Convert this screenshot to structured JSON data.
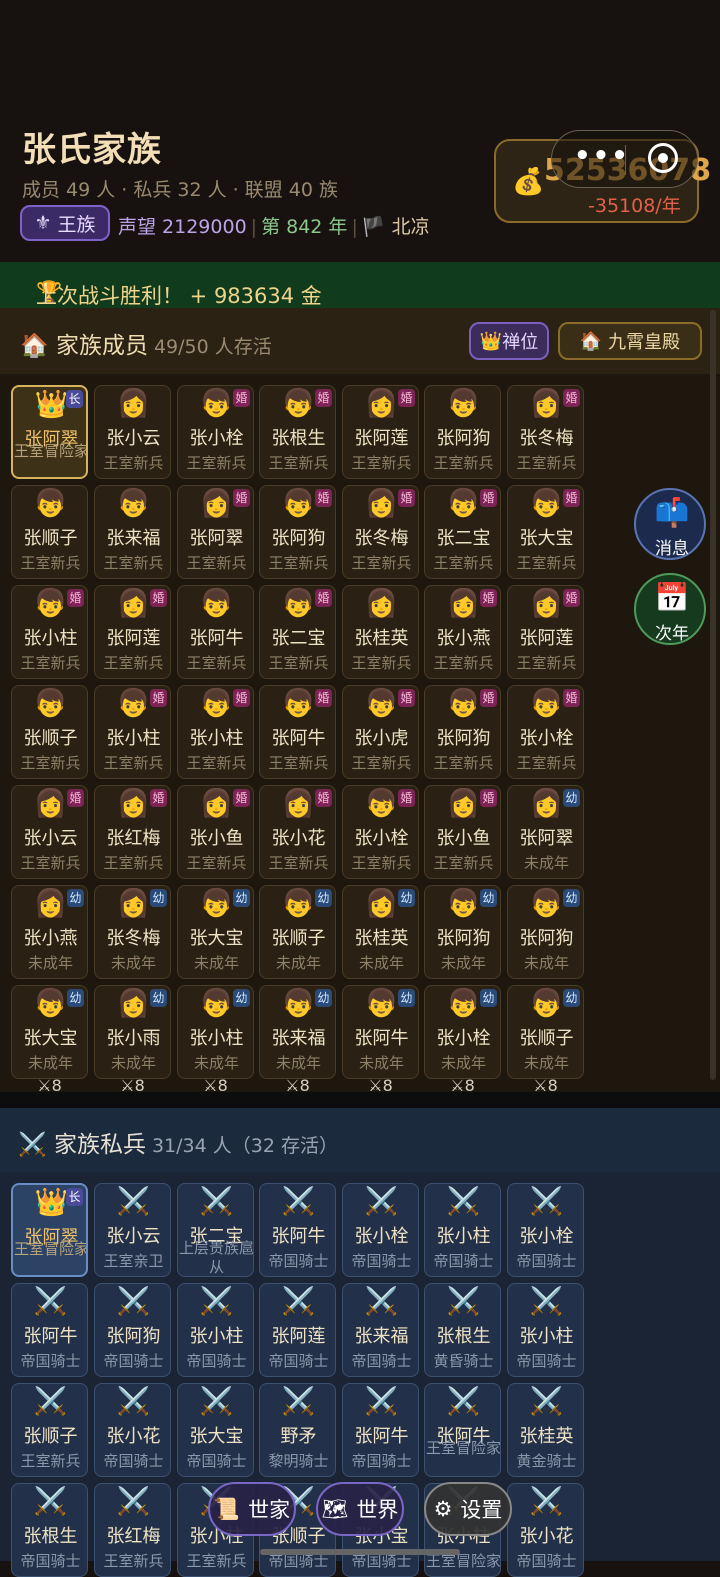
{
  "header": {
    "title": "张氏家族",
    "stats": "成员 49 人 · 私兵 32 人 · 联盟 40 族",
    "rank_badge": "王族",
    "prestige": "声望 2129000",
    "year": "第 842 年",
    "location": "北凉",
    "money": "52536078",
    "money_rate": "-35108/年"
  },
  "victory": {
    "text": "上次战斗胜利！ + 983634 金"
  },
  "members": {
    "title": "家族成员",
    "count": "49/50 人存活",
    "abdicate_label": "禅位",
    "palace_label": "九霄皇殿",
    "cards": [
      {
        "name": "张阿翠",
        "rank": "王室冒险家",
        "avatar": "👑",
        "tag": "长",
        "tag_type": "lead",
        "leader": true
      },
      {
        "name": "张小云",
        "rank": "王室新兵",
        "avatar": "👩",
        "tag": "",
        "tag_type": ""
      },
      {
        "name": "张小栓",
        "rank": "王室新兵",
        "avatar": "👦",
        "tag": "婚",
        "tag_type": "marry"
      },
      {
        "name": "张根生",
        "rank": "王室新兵",
        "avatar": "👦",
        "tag": "婚",
        "tag_type": "marry"
      },
      {
        "name": "张阿莲",
        "rank": "王室新兵",
        "avatar": "👩",
        "tag": "婚",
        "tag_type": "marry"
      },
      {
        "name": "张阿狗",
        "rank": "王室新兵",
        "avatar": "👦",
        "tag": "",
        "tag_type": ""
      },
      {
        "name": "张冬梅",
        "rank": "王室新兵",
        "avatar": "👩",
        "tag": "婚",
        "tag_type": "marry"
      },
      {
        "name": "张顺子",
        "rank": "王室新兵",
        "avatar": "👦",
        "tag": "",
        "tag_type": ""
      },
      {
        "name": "张来福",
        "rank": "王室新兵",
        "avatar": "👦",
        "tag": "",
        "tag_type": ""
      },
      {
        "name": "张阿翠",
        "rank": "王室新兵",
        "avatar": "👩",
        "tag": "婚",
        "tag_type": "marry"
      },
      {
        "name": "张阿狗",
        "rank": "王室新兵",
        "avatar": "👦",
        "tag": "婚",
        "tag_type": "marry"
      },
      {
        "name": "张冬梅",
        "rank": "王室新兵",
        "avatar": "👩",
        "tag": "婚",
        "tag_type": "marry"
      },
      {
        "name": "张二宝",
        "rank": "王室新兵",
        "avatar": "👦",
        "tag": "婚",
        "tag_type": "marry"
      },
      {
        "name": "张大宝",
        "rank": "王室新兵",
        "avatar": "👦",
        "tag": "婚",
        "tag_type": "marry"
      },
      {
        "name": "张小柱",
        "rank": "王室新兵",
        "avatar": "👦",
        "tag": "婚",
        "tag_type": "marry"
      },
      {
        "name": "张阿莲",
        "rank": "王室新兵",
        "avatar": "👩",
        "tag": "婚",
        "tag_type": "marry"
      },
      {
        "name": "张阿牛",
        "rank": "王室新兵",
        "avatar": "👦",
        "tag": "",
        "tag_type": ""
      },
      {
        "name": "张二宝",
        "rank": "王室新兵",
        "avatar": "👦",
        "tag": "婚",
        "tag_type": "marry"
      },
      {
        "name": "张桂英",
        "rank": "王室新兵",
        "avatar": "👩",
        "tag": "",
        "tag_type": ""
      },
      {
        "name": "张小燕",
        "rank": "王室新兵",
        "avatar": "👩",
        "tag": "婚",
        "tag_type": "marry"
      },
      {
        "name": "张阿莲",
        "rank": "王室新兵",
        "avatar": "👩",
        "tag": "婚",
        "tag_type": "marry"
      },
      {
        "name": "张顺子",
        "rank": "王室新兵",
        "avatar": "👦",
        "tag": "",
        "tag_type": ""
      },
      {
        "name": "张小柱",
        "rank": "王室新兵",
        "avatar": "👦",
        "tag": "婚",
        "tag_type": "marry"
      },
      {
        "name": "张小柱",
        "rank": "王室新兵",
        "avatar": "👦",
        "tag": "婚",
        "tag_type": "marry"
      },
      {
        "name": "张阿牛",
        "rank": "王室新兵",
        "avatar": "👦",
        "tag": "婚",
        "tag_type": "marry"
      },
      {
        "name": "张小虎",
        "rank": "王室新兵",
        "avatar": "👦",
        "tag": "婚",
        "tag_type": "marry"
      },
      {
        "name": "张阿狗",
        "rank": "王室新兵",
        "avatar": "👦",
        "tag": "婚",
        "tag_type": "marry"
      },
      {
        "name": "张小栓",
        "rank": "王室新兵",
        "avatar": "👦",
        "tag": "婚",
        "tag_type": "marry"
      },
      {
        "name": "张小云",
        "rank": "王室新兵",
        "avatar": "👩",
        "tag": "婚",
        "tag_type": "marry"
      },
      {
        "name": "张红梅",
        "rank": "王室新兵",
        "avatar": "👩",
        "tag": "婚",
        "tag_type": "marry"
      },
      {
        "name": "张小鱼",
        "rank": "王室新兵",
        "avatar": "👩",
        "tag": "婚",
        "tag_type": "marry"
      },
      {
        "name": "张小花",
        "rank": "王室新兵",
        "avatar": "👩",
        "tag": "婚",
        "tag_type": "marry"
      },
      {
        "name": "张小栓",
        "rank": "王室新兵",
        "avatar": "👦",
        "tag": "婚",
        "tag_type": "marry"
      },
      {
        "name": "张小鱼",
        "rank": "王室新兵",
        "avatar": "👩",
        "tag": "婚",
        "tag_type": "marry"
      },
      {
        "name": "张阿翠",
        "rank": "未成年",
        "avatar": "👩",
        "tag": "幼",
        "tag_type": "young"
      },
      {
        "name": "张小燕",
        "rank": "未成年",
        "avatar": "👩",
        "tag": "幼",
        "tag_type": "young"
      },
      {
        "name": "张冬梅",
        "rank": "未成年",
        "avatar": "👩",
        "tag": "幼",
        "tag_type": "young"
      },
      {
        "name": "张大宝",
        "rank": "未成年",
        "avatar": "👦",
        "tag": "幼",
        "tag_type": "young"
      },
      {
        "name": "张顺子",
        "rank": "未成年",
        "avatar": "👦",
        "tag": "幼",
        "tag_type": "young"
      },
      {
        "name": "张桂英",
        "rank": "未成年",
        "avatar": "👩",
        "tag": "幼",
        "tag_type": "young"
      },
      {
        "name": "张阿狗",
        "rank": "未成年",
        "avatar": "👦",
        "tag": "幼",
        "tag_type": "young"
      },
      {
        "name": "张阿狗",
        "rank": "未成年",
        "avatar": "👦",
        "tag": "幼",
        "tag_type": "young"
      },
      {
        "name": "张大宝",
        "rank": "未成年",
        "avatar": "👦",
        "tag": "幼",
        "tag_type": "young"
      },
      {
        "name": "张小雨",
        "rank": "未成年",
        "avatar": "👩",
        "tag": "幼",
        "tag_type": "young"
      },
      {
        "name": "张小柱",
        "rank": "未成年",
        "avatar": "👦",
        "tag": "幼",
        "tag_type": "young"
      },
      {
        "name": "张来福",
        "rank": "未成年",
        "avatar": "👦",
        "tag": "幼",
        "tag_type": "young"
      },
      {
        "name": "张阿牛",
        "rank": "未成年",
        "avatar": "👦",
        "tag": "幼",
        "tag_type": "young"
      },
      {
        "name": "张小栓",
        "rank": "未成年",
        "avatar": "👦",
        "tag": "幼",
        "tag_type": "young"
      },
      {
        "name": "张顺子",
        "rank": "未成年",
        "avatar": "👦",
        "tag": "幼",
        "tag_type": "young"
      }
    ],
    "footer_counts": [
      "⚔8",
      "⚔8",
      "⚔8",
      "⚔8",
      "⚔8",
      "⚔8",
      "⚔8"
    ]
  },
  "soldiers": {
    "title": "家族私兵",
    "count": "31/34 人（32 存活）",
    "cards": [
      {
        "name": "张阿翠",
        "rank": "王室冒险家",
        "avatar": "👑",
        "tag": "长",
        "leader": true
      },
      {
        "name": "张小云",
        "rank": "王室亲卫",
        "avatar": "⚔️"
      },
      {
        "name": "张二宝",
        "rank": "上层贵族扈从",
        "avatar": "⚔️",
        "wrap": true
      },
      {
        "name": "张阿牛",
        "rank": "帝国骑士",
        "avatar": "⚔️"
      },
      {
        "name": "张小栓",
        "rank": "帝国骑士",
        "avatar": "⚔️"
      },
      {
        "name": "张小柱",
        "rank": "帝国骑士",
        "avatar": "⚔️"
      },
      {
        "name": "张小栓",
        "rank": "帝国骑士",
        "avatar": "⚔️"
      },
      {
        "name": "张阿牛",
        "rank": "帝国骑士",
        "avatar": "⚔️"
      },
      {
        "name": "张阿狗",
        "rank": "帝国骑士",
        "avatar": "⚔️"
      },
      {
        "name": "张小柱",
        "rank": "帝国骑士",
        "avatar": "⚔️"
      },
      {
        "name": "张阿莲",
        "rank": "帝国骑士",
        "avatar": "⚔️"
      },
      {
        "name": "张来福",
        "rank": "帝国骑士",
        "avatar": "⚔️"
      },
      {
        "name": "张根生",
        "rank": "黄昏骑士",
        "avatar": "⚔️"
      },
      {
        "name": "张小柱",
        "rank": "帝国骑士",
        "avatar": "⚔️"
      },
      {
        "name": "张顺子",
        "rank": "王室新兵",
        "avatar": "⚔️"
      },
      {
        "name": "张小花",
        "rank": "帝国骑士",
        "avatar": "⚔️"
      },
      {
        "name": "张大宝",
        "rank": "帝国骑士",
        "avatar": "⚔️"
      },
      {
        "name": "野矛",
        "rank": "黎明骑士",
        "avatar": "⚔️"
      },
      {
        "name": "张阿牛",
        "rank": "帝国骑士",
        "avatar": "⚔️"
      },
      {
        "name": "张阿牛",
        "rank": "王室冒险家",
        "avatar": "⚔️",
        "wrap": true
      },
      {
        "name": "张桂英",
        "rank": "黄金骑士",
        "avatar": "⚔️"
      },
      {
        "name": "张根生",
        "rank": "帝国骑士",
        "avatar": "⚔️"
      },
      {
        "name": "张红梅",
        "rank": "王室新兵",
        "avatar": "⚔️"
      },
      {
        "name": "张小柱",
        "rank": "王室新兵",
        "avatar": "⚔️"
      },
      {
        "name": "张顺子",
        "rank": "帝国骑士",
        "avatar": "⚔️"
      },
      {
        "name": "张小宝",
        "rank": "帝国骑士",
        "avatar": "⚔️"
      },
      {
        "name": "张小柱",
        "rank": "王室冒险家",
        "avatar": "⚔️"
      },
      {
        "name": "张小花",
        "rank": "帝国骑士",
        "avatar": "⚔️"
      }
    ]
  },
  "side": {
    "messages_label": "消息",
    "next_year_label": "次年"
  },
  "nav": {
    "family_label": "世家",
    "world_label": "世界",
    "settings_label": "设置"
  },
  "colors": {
    "gold": "#e0a64a",
    "victory_bg": "#103b1c",
    "member_bg": "#1e170e",
    "soldier_bg": "#1a2434",
    "deficit": "#e3604a"
  }
}
